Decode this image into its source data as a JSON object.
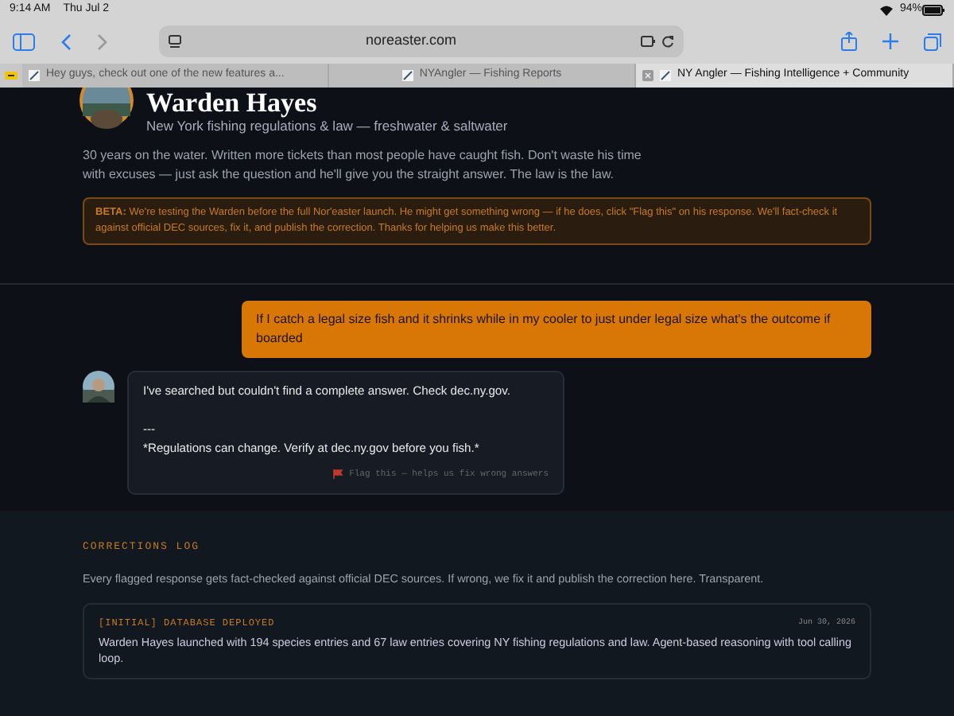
{
  "status_bar": {
    "time": "9:14 AM",
    "date": "Thu Jul 2",
    "battery": "94%"
  },
  "toolbar": {
    "url": "noreaster.com"
  },
  "tabs": [
    {
      "title": "Hey guys, check out one of the new features a...",
      "selected": false
    },
    {
      "title": "NYAngler — Fishing Reports",
      "selected": false
    },
    {
      "title": "NY Angler — Fishing Intelligence + Community",
      "selected": true
    }
  ],
  "profile": {
    "name": "Warden Hayes",
    "subtitle": "New York fishing regulations & law — freshwater & saltwater",
    "bio": "30 years on the water. Written more tickets than most people have caught fish. Don't waste his time with excuses — just ask the question and he'll give you the straight answer. The law is the law."
  },
  "beta_notice": "**BETA:** We're testing the Warden before the full Nor'easter launch. He might get something wrong — if he does, click \"Flag this\" on his response. We'll fact-check it against official DEC sources, fix it, and publish the correction. Thanks for helping us make this better.",
  "messages": [
    {
      "kind": "question",
      "text": "If I catch a legal size fish and it shrinks while in my cooler to just under legal size what's the outcome if boarded"
    },
    {
      "kind": "answer",
      "lines": [
        "I've searched but couldn't find a complete answer. Check dec.ny.gov.",
        "---",
        "*Regulations can change. Verify at dec.ny.gov before you fish.*"
      ],
      "flag": "Flag this — helps us fix wrong answers"
    }
  ],
  "corrections": {
    "title": "CORRECTIONS LOG",
    "description": "Every flagged response gets fact-checked against official DEC sources. If wrong, we fix it and publish the correction here. Transparent.",
    "entries": [
      {
        "tag": "[INITIAL] DATABASE DEPLOYED",
        "date": "Jun 30, 2026",
        "text": "Warden Hayes launched with 194 species entries and 67 law entries covering NY fishing regulations and law. Agent-based reasoning with tool calling loop."
      }
    ]
  }
}
